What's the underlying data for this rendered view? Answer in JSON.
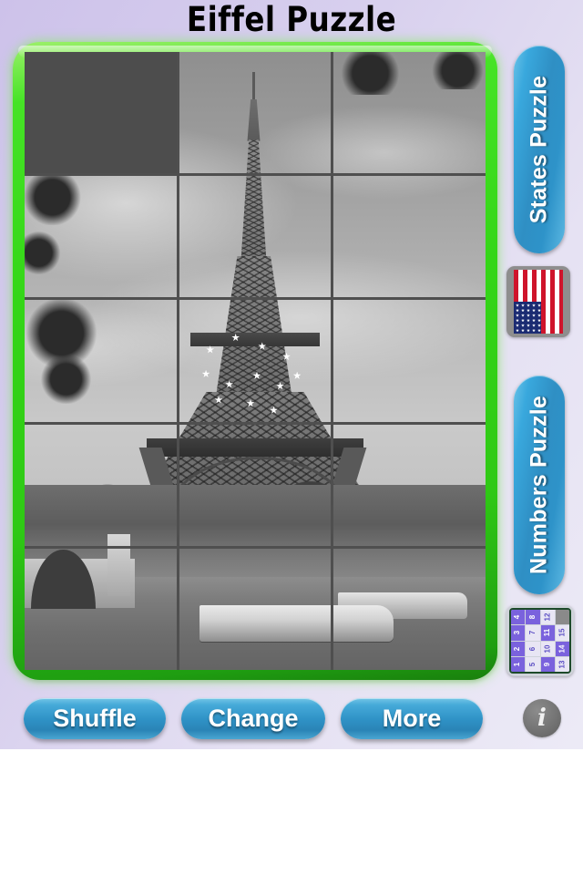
{
  "app": {
    "title": "Eiffel Puzzle",
    "background_top": "#cdc2ea",
    "background_bottom": "#eceaf6"
  },
  "puzzle": {
    "frame_color": "#34d617",
    "columns": 3,
    "rows": 5,
    "image_subject": "Eiffel Tower, Paris (black and white)",
    "empty_tile_index": 0,
    "empty_tile_color": "#4d4d4d",
    "grid_line_color": "#4f4f4f",
    "tiles": [
      {
        "index": 0,
        "state": "empty"
      },
      {
        "index": 1,
        "state": "filled"
      },
      {
        "index": 2,
        "state": "filled"
      },
      {
        "index": 3,
        "state": "filled"
      },
      {
        "index": 4,
        "state": "filled"
      },
      {
        "index": 5,
        "state": "filled"
      },
      {
        "index": 6,
        "state": "filled"
      },
      {
        "index": 7,
        "state": "filled"
      },
      {
        "index": 8,
        "state": "filled"
      },
      {
        "index": 9,
        "state": "filled"
      },
      {
        "index": 10,
        "state": "filled"
      },
      {
        "index": 11,
        "state": "filled"
      },
      {
        "index": 12,
        "state": "filled"
      },
      {
        "index": 13,
        "state": "filled"
      },
      {
        "index": 14,
        "state": "filled"
      }
    ]
  },
  "sidebar": {
    "states_button": {
      "label": "States Puzzle",
      "icon": "flag-icon",
      "color": "#2f8fc4"
    },
    "numbers_button": {
      "label": "Numbers Puzzle",
      "icon": "numbers-grid-icon",
      "color": "#2f8fc4"
    },
    "flag_icon": {
      "name": "us-flag-icon",
      "stripe_color": "#cf142b",
      "canton_color": "#1b2b72"
    },
    "numbers_thumb": {
      "name": "numbers-grid-icon",
      "tile_color": "#7a62dd",
      "alt_tile_color": "#e8e6f4",
      "cells": [
        {
          "value": "4",
          "style": "dark"
        },
        {
          "value": "8",
          "style": "dark"
        },
        {
          "value": "12",
          "style": "light"
        },
        {
          "value": "",
          "style": "blank"
        },
        {
          "value": "3",
          "style": "dark"
        },
        {
          "value": "7",
          "style": "light"
        },
        {
          "value": "11",
          "style": "dark"
        },
        {
          "value": "15",
          "style": "light"
        },
        {
          "value": "2",
          "style": "dark"
        },
        {
          "value": "6",
          "style": "light"
        },
        {
          "value": "10",
          "style": "light"
        },
        {
          "value": "14",
          "style": "dark"
        },
        {
          "value": "1",
          "style": "dark"
        },
        {
          "value": "5",
          "style": "light"
        },
        {
          "value": "9",
          "style": "dark"
        },
        {
          "value": "13",
          "style": "light"
        }
      ]
    }
  },
  "toolbar": {
    "shuffle_label": "Shuffle",
    "change_label": "Change",
    "more_label": "More",
    "info_label": "i"
  }
}
